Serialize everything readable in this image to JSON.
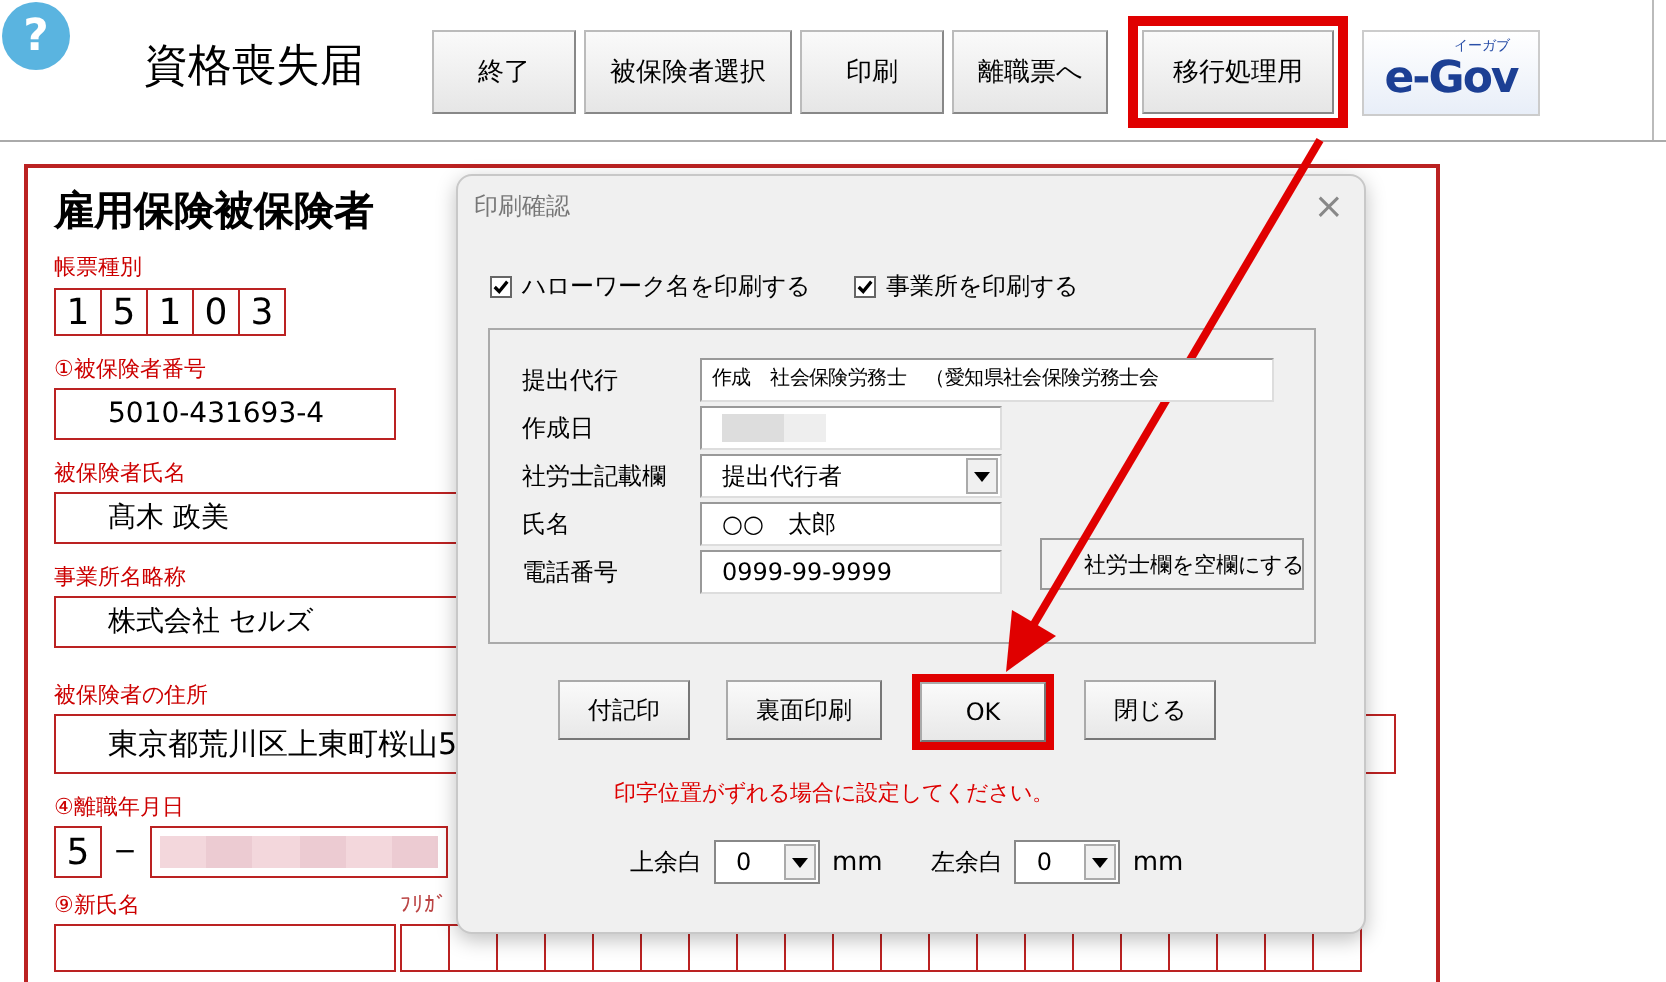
{
  "help_icon": "?",
  "title": "資格喪失届",
  "toolbar": [
    {
      "label": "終了",
      "highlighted": false
    },
    {
      "label": "被保険者選択",
      "highlighted": false
    },
    {
      "label": "印刷",
      "highlighted": false
    },
    {
      "label": "離職票へ",
      "highlighted": false
    },
    {
      "label": "移行処理用",
      "highlighted": true
    }
  ],
  "logo": {
    "text": "e-Gov",
    "ruby": "イーガブ"
  },
  "form": {
    "title": "雇用保険被保険者",
    "form_type": {
      "label": "帳票種別",
      "digits": [
        "1",
        "5",
        "1",
        "0",
        "3"
      ]
    },
    "fields": [
      {
        "label": "①被保険者番号",
        "value": "5010-431693-4",
        "kind": "short"
      },
      {
        "label": "被保険者氏名",
        "value": "髙木 政美",
        "kind": "wide"
      },
      {
        "label": "事業所名略称",
        "value": "株式会社 セルズ",
        "kind": "wide"
      },
      {
        "label": "被保険者の住所",
        "value": "東京都荒川区上東町桜山5",
        "kind": "full"
      }
    ],
    "separation_date": {
      "label": "④離職年月日",
      "era": "5",
      "dash": "−"
    },
    "new_name": {
      "label": "⑨新氏名"
    },
    "furigana": {
      "label": "ﾌﾘｶﾞ"
    }
  },
  "dialog": {
    "title": "印刷確認",
    "close": "×",
    "checkboxes": [
      {
        "label": "ハローワーク名を印刷する",
        "checked": true
      },
      {
        "label": "事業所を印刷する",
        "checked": true
      }
    ],
    "fields": [
      {
        "kind": "long",
        "label": "提出代行",
        "value": "作成　社会保険労務士　（愛知県社会保険労務士会"
      },
      {
        "kind": "redacted",
        "label": "作成日"
      },
      {
        "kind": "select",
        "label": "社労士記載欄",
        "value": "提出代行者"
      },
      {
        "kind": "text",
        "label": "氏名",
        "value": "○○　太郎"
      },
      {
        "kind": "text",
        "label": "電話番号",
        "value": "0999-99-9999"
      }
    ],
    "clear_button": "社労士欄を空欄にする",
    "buttons": [
      {
        "label": "付記印",
        "highlighted": false
      },
      {
        "label": "裏面印刷",
        "highlighted": false
      },
      {
        "label": "OK",
        "highlighted": true
      },
      {
        "label": "閉じる",
        "highlighted": false
      }
    ],
    "note": "印字位置がずれる場合に設定してください。",
    "margins": [
      {
        "label": "上余白",
        "value": "0",
        "unit": "mm"
      },
      {
        "label": "左余白",
        "value": "0",
        "unit": "mm"
      }
    ]
  }
}
